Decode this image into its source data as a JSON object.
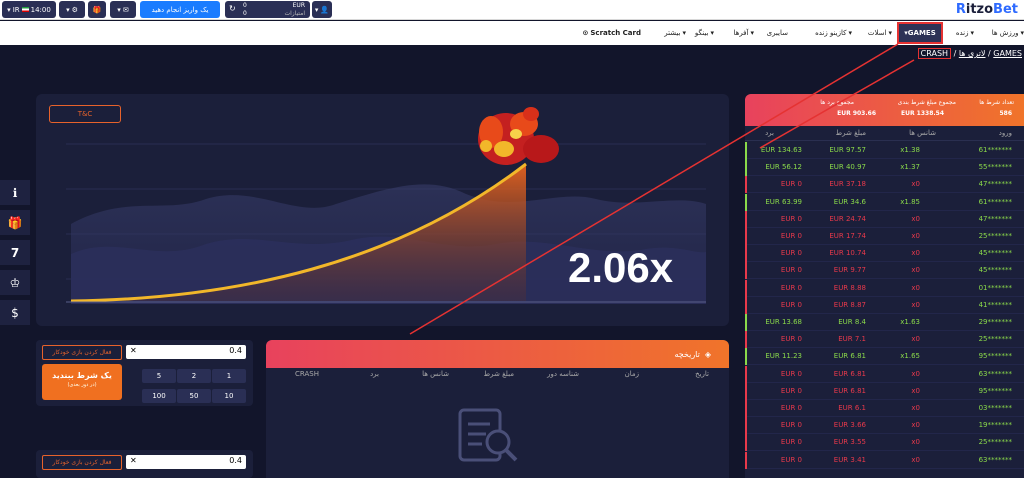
{
  "header": {
    "time": "14:00",
    "region": "IR",
    "deposit_label": "یک واریز انجام دهید",
    "balance_currency": "EUR",
    "balance_label": "امتیازات",
    "balance_value1": "0",
    "balance_value2": "0",
    "logo_main": "itzo",
    "logo_accent": "Bet",
    "logo_initial": "R"
  },
  "nav": {
    "games": "GAMES",
    "items": [
      "ورزش ها",
      "زنده",
      "اسلات",
      "کازینو زنده",
      "سایبری",
      "آفرها",
      "بینگو",
      "بیشتر",
      "Scratch Card"
    ]
  },
  "breadcrumb": {
    "games": "GAMES",
    "lottery": "لاتری ها",
    "crash": "CRASH"
  },
  "game": {
    "tc": "T&C",
    "multiplier": "2.06x"
  },
  "bet1": {
    "auto_label": "فعال کردن بازی خودکار",
    "amount": "0.4",
    "button_title": "یک شرط ببندید",
    "button_sub": "(در دور بعدی)",
    "quick": [
      "1",
      "2",
      "5",
      "10",
      "50",
      "100"
    ]
  },
  "bet2": {
    "auto_label": "فعال کردن بازی خودکار",
    "amount": "0.4"
  },
  "history": {
    "title": "تاریخچه",
    "columns": [
      "تاریخ",
      "زمان",
      "شناسه دور",
      "مبلغ شرط",
      "شانس ها",
      "برد",
      "CRASH"
    ]
  },
  "bets_table": {
    "total_bets_label": "تعداد شرط ها",
    "total_bets_value": "586",
    "total_amount_label": "مجموع مبلغ شرط بندی",
    "total_amount_value": "EUR 1338.54",
    "total_win_label": "مجموع برد ها",
    "total_win_value": "EUR 903.66",
    "columns": [
      "ورود",
      "شانس ها",
      "مبلغ شرط",
      "برد"
    ],
    "rows": [
      {
        "user": "61*******",
        "odds": "x1.38",
        "bet": "EUR 97.57",
        "win": "EUR 134.63",
        "won": true
      },
      {
        "user": "55*******",
        "odds": "x1.37",
        "bet": "EUR 40.97",
        "win": "EUR 56.12",
        "won": true
      },
      {
        "user": "47*******",
        "odds": "x0",
        "bet": "EUR 37.18",
        "win": "EUR 0",
        "won": false
      },
      {
        "user": "61*******",
        "odds": "x1.85",
        "bet": "EUR 34.6",
        "win": "EUR 63.99",
        "won": true
      },
      {
        "user": "47*******",
        "odds": "x0",
        "bet": "EUR 24.74",
        "win": "EUR 0",
        "won": false
      },
      {
        "user": "25*******",
        "odds": "x0",
        "bet": "EUR 17.74",
        "win": "EUR 0",
        "won": false
      },
      {
        "user": "45*******",
        "odds": "x0",
        "bet": "EUR 10.74",
        "win": "EUR 0",
        "won": false
      },
      {
        "user": "45*******",
        "odds": "x0",
        "bet": "EUR 9.77",
        "win": "EUR 0",
        "won": false
      },
      {
        "user": "01*******",
        "odds": "x0",
        "bet": "EUR 8.88",
        "win": "EUR 0",
        "won": false
      },
      {
        "user": "41*******",
        "odds": "x0",
        "bet": "EUR 8.87",
        "win": "EUR 0",
        "won": false
      },
      {
        "user": "29*******",
        "odds": "x1.63",
        "bet": "EUR 8.4",
        "win": "EUR 13.68",
        "won": true
      },
      {
        "user": "25*******",
        "odds": "x0",
        "bet": "EUR 7.1",
        "win": "EUR 0",
        "won": false
      },
      {
        "user": "95*******",
        "odds": "x1.65",
        "bet": "EUR 6.81",
        "win": "EUR 11.23",
        "won": true
      },
      {
        "user": "63*******",
        "odds": "x0",
        "bet": "EUR 6.81",
        "win": "EUR 0",
        "won": false
      },
      {
        "user": "95*******",
        "odds": "x0",
        "bet": "EUR 6.81",
        "win": "EUR 0",
        "won": false
      },
      {
        "user": "03*******",
        "odds": "x0",
        "bet": "EUR 6.1",
        "win": "EUR 0",
        "won": false
      },
      {
        "user": "19*******",
        "odds": "x0",
        "bet": "EUR 3.66",
        "win": "EUR 0",
        "won": false
      },
      {
        "user": "25*******",
        "odds": "x0",
        "bet": "EUR 3.55",
        "win": "EUR 0",
        "won": false
      },
      {
        "user": "63*******",
        "odds": "x0",
        "bet": "EUR 3.41",
        "win": "EUR 0",
        "won": false
      }
    ]
  },
  "side_icons": [
    "info-icon",
    "gift-icon",
    "seven-icon",
    "trophy-icon",
    "dollar-icon"
  ],
  "colors": {
    "accent": "#f07020",
    "brand": "#2f6bff",
    "win": "#8ad94a",
    "lose": "#e8394b",
    "highlight": "#e53232"
  }
}
